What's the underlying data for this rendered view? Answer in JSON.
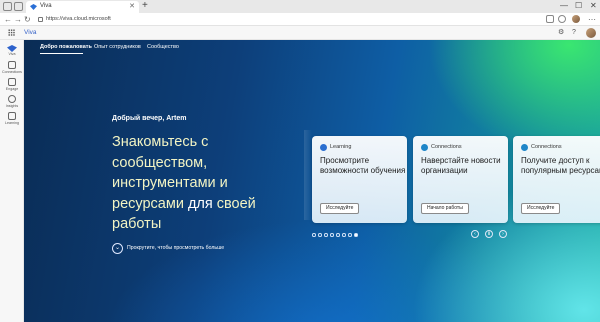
{
  "browser": {
    "tab_title": "Viva",
    "tab_close": "✕",
    "new_tab": "+",
    "url": "https://viva.cloud.microsoft",
    "window_controls": [
      "—",
      "☐",
      "✕"
    ]
  },
  "app": {
    "brand": "Viva",
    "header_icons": [
      "notifications-icon",
      "help-icon",
      "avatar"
    ]
  },
  "rail": [
    {
      "label": "Viva",
      "icon": "viva-icon"
    },
    {
      "label": "Connections",
      "icon": "connections-icon"
    },
    {
      "label": "Engage",
      "icon": "engage-icon"
    },
    {
      "label": "Insights",
      "icon": "insights-icon"
    },
    {
      "label": "Learning",
      "icon": "learning-icon"
    }
  ],
  "topnav": {
    "items": [
      "Добро пожаловать",
      "Опыт сотрудников",
      "Сообщество"
    ],
    "active_index": 0
  },
  "hero": {
    "greeting": "Добрый вечер, Artem",
    "headline_parts": [
      {
        "text": "Знакомьтесь с ",
        "white": false
      },
      {
        "text": "сообществом, ",
        "white": false
      },
      {
        "text": "инструментами ",
        "white": false
      },
      {
        "text": "и ресурсами ",
        "white": false
      },
      {
        "text": "для ",
        "white": true
      },
      {
        "text": "своей работы",
        "white": false
      }
    ],
    "scroll_hint": "Прокрутите, чтобы просмотреть больше"
  },
  "cards": [
    {
      "tag": "Learning",
      "title": "Просмотрите возможности обучения",
      "button": "Исследуйте"
    },
    {
      "tag": "Connections",
      "title": "Наверстайте новости организации",
      "button": "Начало работы"
    },
    {
      "tag": "Connections",
      "title": "Получите доступ к популярным ресурсам",
      "button": "Исследуйте"
    }
  ],
  "carousel": {
    "dot_count": 8,
    "active_dot": 7,
    "prev": "‹",
    "pause": "Ⅱ",
    "next": "›"
  },
  "colors": {
    "accent": "#2d62cc",
    "headline_yellow": "#f2f4c4"
  }
}
